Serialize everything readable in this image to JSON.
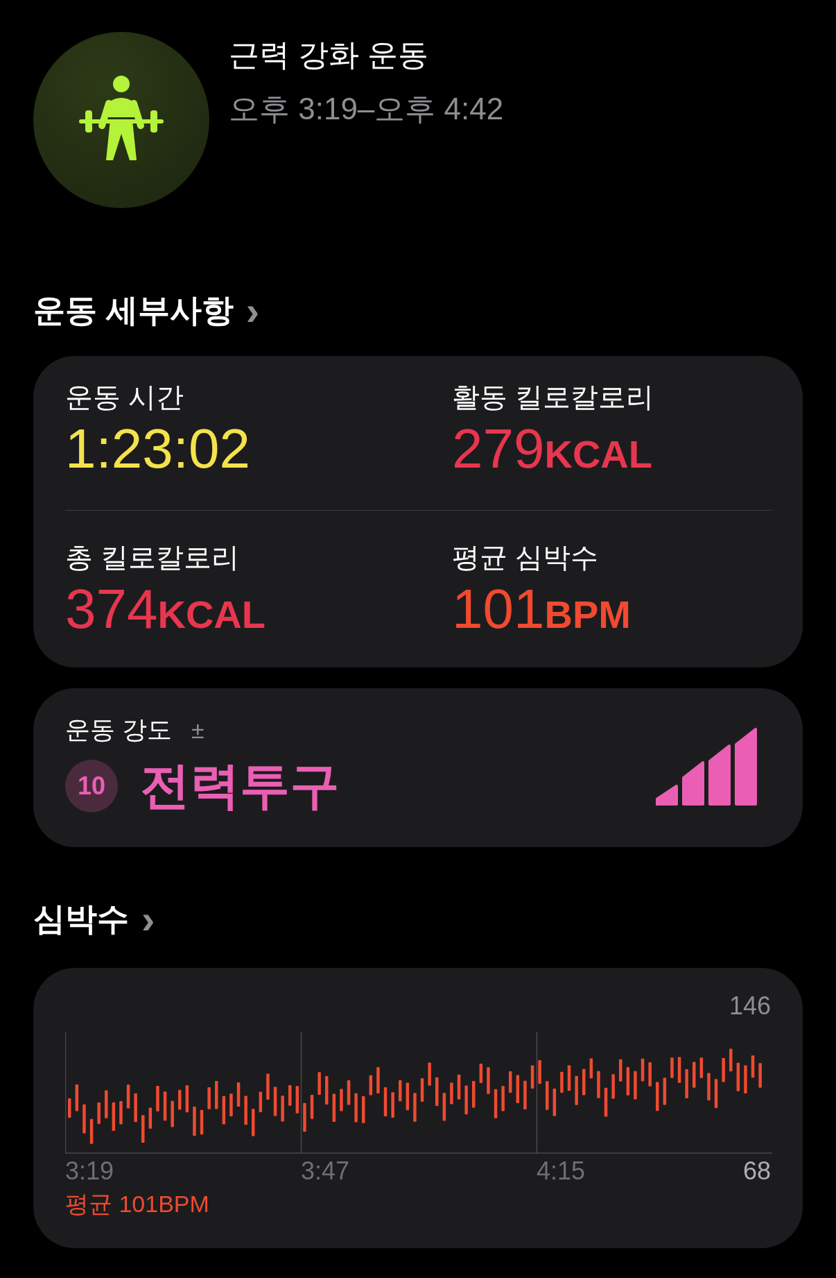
{
  "workout": {
    "title": "근력 강화 운동",
    "time_range": "오후 3:19–오후 4:42"
  },
  "details_section": {
    "title": "운동 세부사항",
    "chevron": "›"
  },
  "stats": [
    {
      "label": "운동 시간",
      "value": "1:23:02",
      "color": "#f4e24c"
    },
    {
      "label": "활동 킬로칼로리",
      "value": "279",
      "unit": "KCAL",
      "color": "#e8364f"
    },
    {
      "label": "총 킬로칼로리",
      "value": "374",
      "unit": "KCAL",
      "color": "#e8364f"
    },
    {
      "label": "평균 심박수",
      "value": "101",
      "unit": "BPM",
      "color": "#f04a30"
    }
  ],
  "intensity": {
    "label": "운동 강도",
    "info": "±",
    "score": "10",
    "name": "전력투구"
  },
  "heart_section": {
    "title": "심박수",
    "chevron": "›"
  },
  "heart_chart": {
    "max_label": "146",
    "min_label": "68",
    "times": [
      "3:19",
      "3:47",
      "4:15"
    ],
    "average": "평균 101BPM"
  }
}
